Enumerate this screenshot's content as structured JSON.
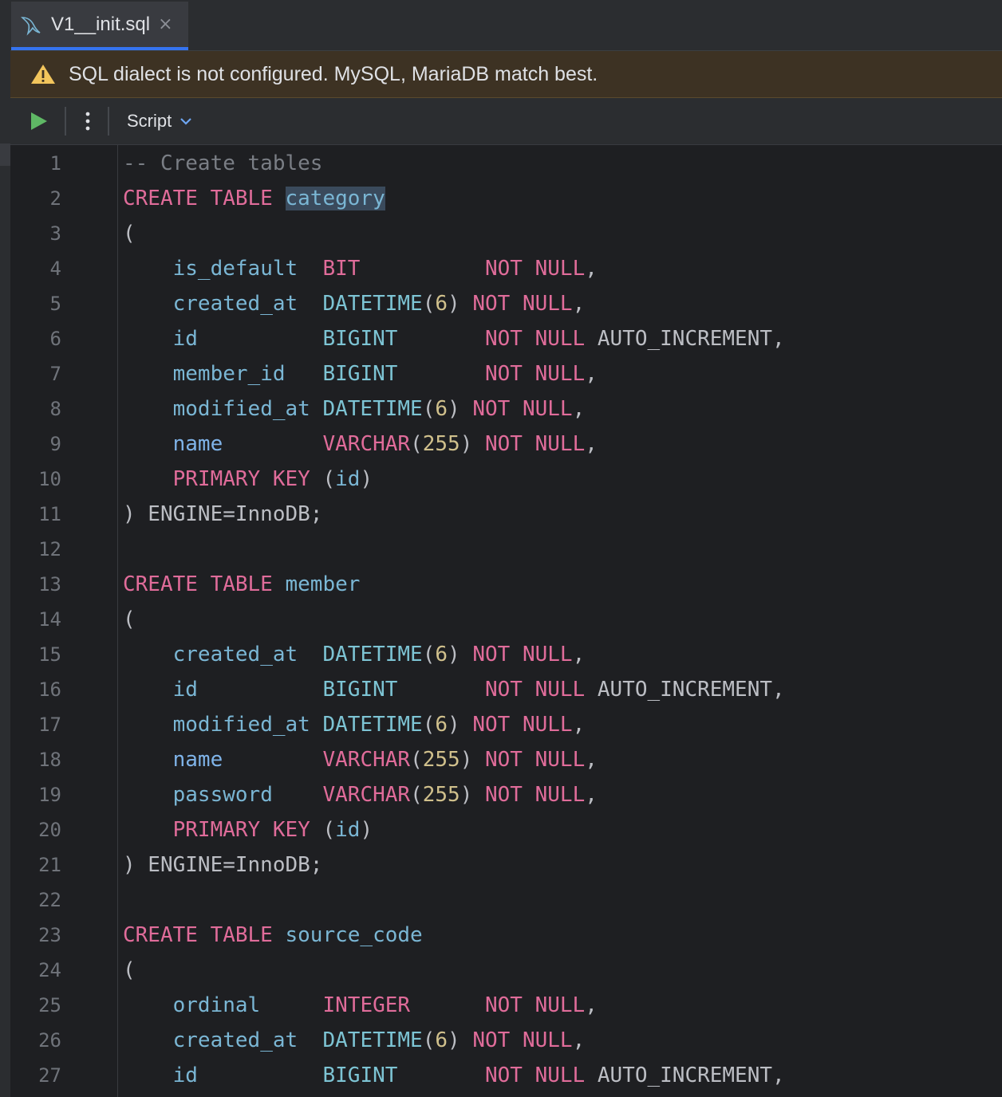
{
  "tab": {
    "title": "V1__init.sql",
    "close": "×"
  },
  "warning": {
    "text": "SQL dialect is not configured. MySQL, MariaDB match best."
  },
  "toolbar": {
    "script_label": "Script"
  },
  "colors": {
    "accent": "#3574f0",
    "keyword": "#e06c9a",
    "identifier": "#7ab6d4",
    "number": "#d0c08c",
    "comment": "#7a7e85",
    "warning_bg": "#3d3223"
  },
  "lines": [
    [
      {
        "t": "-- Create tables",
        "c": "cm"
      }
    ],
    [
      {
        "t": "CREATE TABLE",
        "c": "kw"
      },
      {
        "t": " "
      },
      {
        "t": "category",
        "c": "id hl"
      }
    ],
    [
      {
        "t": "("
      }
    ],
    [
      {
        "t": "    "
      },
      {
        "t": "is_default",
        "c": "id"
      },
      {
        "t": "  "
      },
      {
        "t": "BIT",
        "c": "kw"
      },
      {
        "t": "          "
      },
      {
        "t": "NOT NULL",
        "c": "kw"
      },
      {
        "t": ","
      }
    ],
    [
      {
        "t": "    "
      },
      {
        "t": "created_at",
        "c": "id"
      },
      {
        "t": "  "
      },
      {
        "t": "DATETIME",
        "c": "tp"
      },
      {
        "t": "("
      },
      {
        "t": "6",
        "c": "nm"
      },
      {
        "t": ") "
      },
      {
        "t": "NOT NULL",
        "c": "kw"
      },
      {
        "t": ","
      }
    ],
    [
      {
        "t": "    "
      },
      {
        "t": "id",
        "c": "id"
      },
      {
        "t": "          "
      },
      {
        "t": "BIGINT",
        "c": "tp"
      },
      {
        "t": "       "
      },
      {
        "t": "NOT NULL",
        "c": "kw"
      },
      {
        "t": " AUTO_INCREMENT,"
      }
    ],
    [
      {
        "t": "    "
      },
      {
        "t": "member_id",
        "c": "id"
      },
      {
        "t": "   "
      },
      {
        "t": "BIGINT",
        "c": "tp"
      },
      {
        "t": "       "
      },
      {
        "t": "NOT NULL",
        "c": "kw"
      },
      {
        "t": ","
      }
    ],
    [
      {
        "t": "    "
      },
      {
        "t": "modified_at",
        "c": "id"
      },
      {
        "t": " "
      },
      {
        "t": "DATETIME",
        "c": "tp"
      },
      {
        "t": "("
      },
      {
        "t": "6",
        "c": "nm"
      },
      {
        "t": ") "
      },
      {
        "t": "NOT NULL",
        "c": "kw"
      },
      {
        "t": ","
      }
    ],
    [
      {
        "t": "    "
      },
      {
        "t": "name",
        "c": "nm-col"
      },
      {
        "t": "        "
      },
      {
        "t": "VARCHAR",
        "c": "kw"
      },
      {
        "t": "("
      },
      {
        "t": "255",
        "c": "nm"
      },
      {
        "t": ") "
      },
      {
        "t": "NOT NULL",
        "c": "kw"
      },
      {
        "t": ","
      }
    ],
    [
      {
        "t": "    "
      },
      {
        "t": "PRIMARY KEY",
        "c": "kw"
      },
      {
        "t": " ("
      },
      {
        "t": "id",
        "c": "id"
      },
      {
        "t": ")"
      }
    ],
    [
      {
        "t": ") ENGINE=InnoDB;"
      }
    ],
    [],
    [
      {
        "t": "CREATE TABLE",
        "c": "kw"
      },
      {
        "t": " "
      },
      {
        "t": "member",
        "c": "id"
      }
    ],
    [
      {
        "t": "("
      }
    ],
    [
      {
        "t": "    "
      },
      {
        "t": "created_at",
        "c": "id"
      },
      {
        "t": "  "
      },
      {
        "t": "DATETIME",
        "c": "tp"
      },
      {
        "t": "("
      },
      {
        "t": "6",
        "c": "nm"
      },
      {
        "t": ") "
      },
      {
        "t": "NOT NULL",
        "c": "kw"
      },
      {
        "t": ","
      }
    ],
    [
      {
        "t": "    "
      },
      {
        "t": "id",
        "c": "id"
      },
      {
        "t": "          "
      },
      {
        "t": "BIGINT",
        "c": "tp"
      },
      {
        "t": "       "
      },
      {
        "t": "NOT NULL",
        "c": "kw"
      },
      {
        "t": " AUTO_INCREMENT,"
      }
    ],
    [
      {
        "t": "    "
      },
      {
        "t": "modified_at",
        "c": "id"
      },
      {
        "t": " "
      },
      {
        "t": "DATETIME",
        "c": "tp"
      },
      {
        "t": "("
      },
      {
        "t": "6",
        "c": "nm"
      },
      {
        "t": ") "
      },
      {
        "t": "NOT NULL",
        "c": "kw"
      },
      {
        "t": ","
      }
    ],
    [
      {
        "t": "    "
      },
      {
        "t": "name",
        "c": "nm-col"
      },
      {
        "t": "        "
      },
      {
        "t": "VARCHAR",
        "c": "kw"
      },
      {
        "t": "("
      },
      {
        "t": "255",
        "c": "nm"
      },
      {
        "t": ") "
      },
      {
        "t": "NOT NULL",
        "c": "kw"
      },
      {
        "t": ","
      }
    ],
    [
      {
        "t": "    "
      },
      {
        "t": "password",
        "c": "id"
      },
      {
        "t": "    "
      },
      {
        "t": "VARCHAR",
        "c": "kw"
      },
      {
        "t": "("
      },
      {
        "t": "255",
        "c": "nm"
      },
      {
        "t": ") "
      },
      {
        "t": "NOT NULL",
        "c": "kw"
      },
      {
        "t": ","
      }
    ],
    [
      {
        "t": "    "
      },
      {
        "t": "PRIMARY KEY",
        "c": "kw"
      },
      {
        "t": " ("
      },
      {
        "t": "id",
        "c": "id"
      },
      {
        "t": ")"
      }
    ],
    [
      {
        "t": ") ENGINE=InnoDB;"
      }
    ],
    [],
    [
      {
        "t": "CREATE TABLE",
        "c": "kw"
      },
      {
        "t": " "
      },
      {
        "t": "source_code",
        "c": "id"
      }
    ],
    [
      {
        "t": "("
      }
    ],
    [
      {
        "t": "    "
      },
      {
        "t": "ordinal",
        "c": "id"
      },
      {
        "t": "     "
      },
      {
        "t": "INTEGER",
        "c": "kw"
      },
      {
        "t": "      "
      },
      {
        "t": "NOT NULL",
        "c": "kw"
      },
      {
        "t": ","
      }
    ],
    [
      {
        "t": "    "
      },
      {
        "t": "created_at",
        "c": "id"
      },
      {
        "t": "  "
      },
      {
        "t": "DATETIME",
        "c": "tp"
      },
      {
        "t": "("
      },
      {
        "t": "6",
        "c": "nm"
      },
      {
        "t": ") "
      },
      {
        "t": "NOT NULL",
        "c": "kw"
      },
      {
        "t": ","
      }
    ],
    [
      {
        "t": "    "
      },
      {
        "t": "id",
        "c": "id"
      },
      {
        "t": "          "
      },
      {
        "t": "BIGINT",
        "c": "tp"
      },
      {
        "t": "       "
      },
      {
        "t": "NOT NULL",
        "c": "kw"
      },
      {
        "t": " AUTO_INCREMENT,"
      }
    ]
  ]
}
